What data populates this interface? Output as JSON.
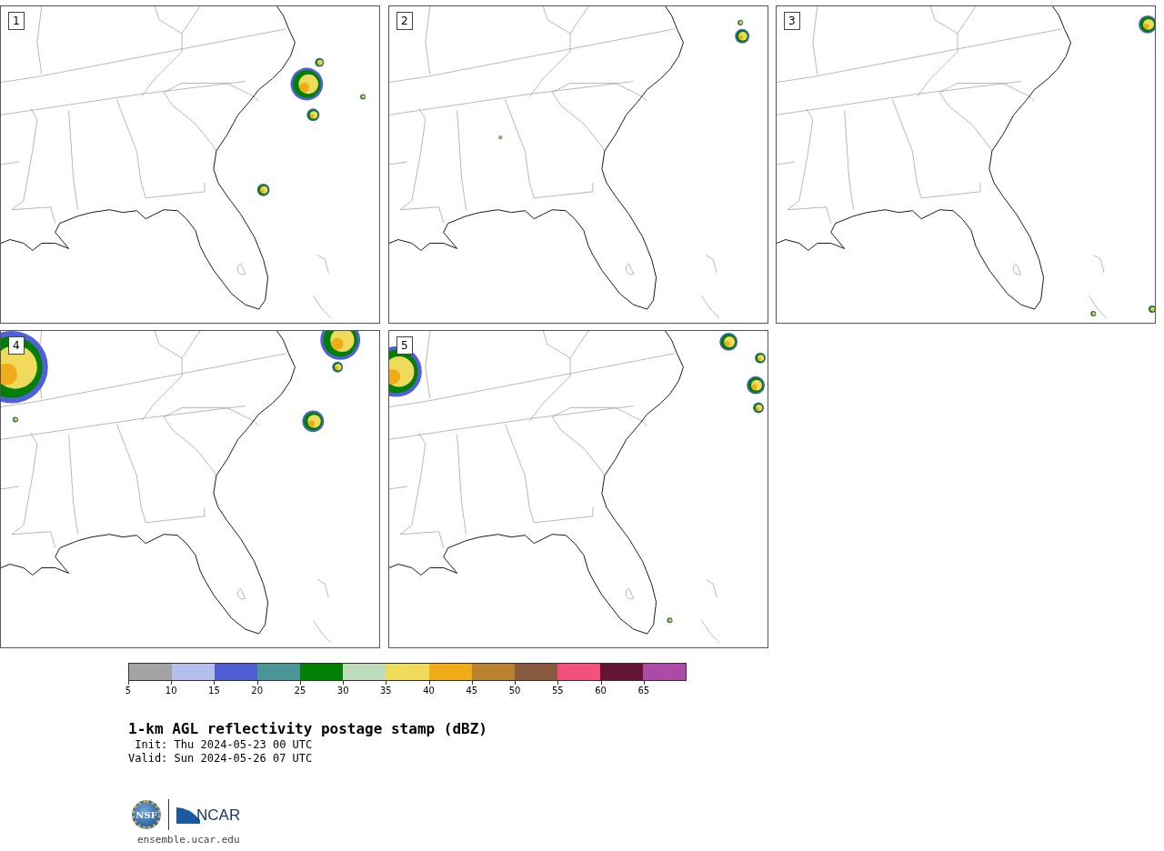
{
  "panels": [
    {
      "label": "1"
    },
    {
      "label": "2"
    },
    {
      "label": "3"
    },
    {
      "label": "4"
    },
    {
      "label": "5"
    }
  ],
  "colorbar": {
    "bins": [
      {
        "color": "#a3a3a3"
      },
      {
        "color": "#b5bfeb"
      },
      {
        "color": "#505ed6"
      },
      {
        "color": "#4a9598"
      },
      {
        "color": "#008000"
      },
      {
        "color": "#bcdcbc"
      },
      {
        "color": "#f0da5c"
      },
      {
        "color": "#f0ac18"
      },
      {
        "color": "#b8822f"
      },
      {
        "color": "#8a5a3e"
      },
      {
        "color": "#f4507c"
      },
      {
        "color": "#621634"
      },
      {
        "color": "#ad4aa8"
      }
    ],
    "ticks": [
      "5",
      "10",
      "15",
      "20",
      "25",
      "30",
      "35",
      "40",
      "45",
      "50",
      "55",
      "60",
      "65"
    ]
  },
  "title": "1-km AGL reflectivity postage stamp (dBZ)",
  "init": " Init: Thu 2024-05-23 00 UTC",
  "valid": "Valid: Sun 2024-05-26 07 UTC",
  "logo": {
    "seal": "NSF",
    "wordmark": "NCAR"
  },
  "url": "ensemble.ucar.edu"
}
